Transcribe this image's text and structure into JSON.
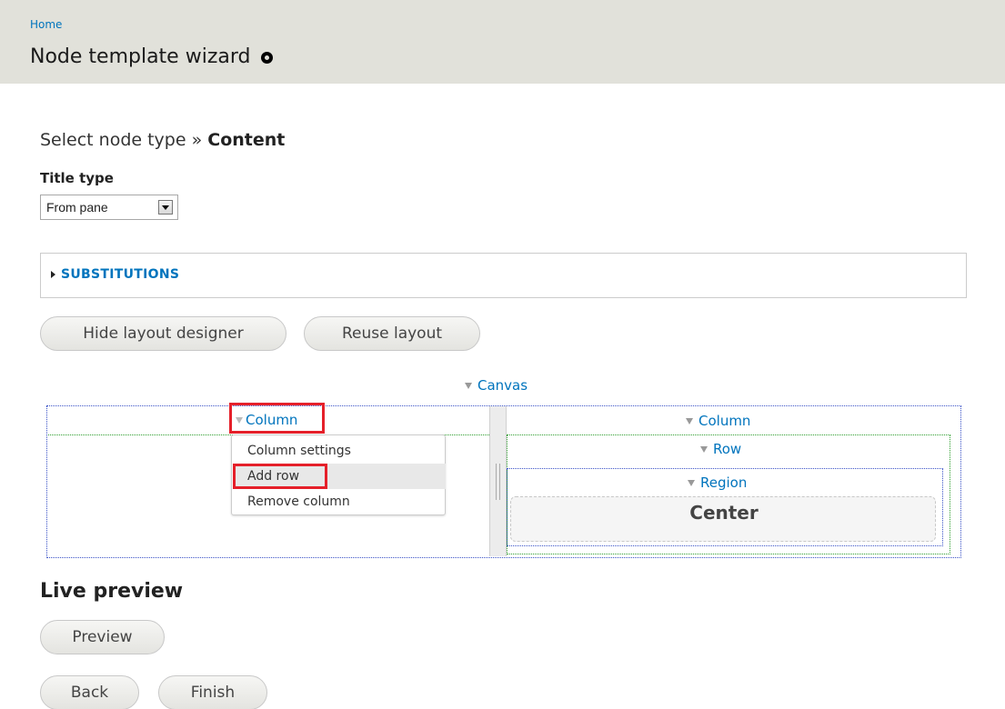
{
  "header": {
    "breadcrumb": "Home",
    "title": "Node template wizard",
    "shortcut_icon": "add-shortcut-icon"
  },
  "wizard": {
    "step_previous": "Select node type",
    "separator": " » ",
    "step_current": "Content"
  },
  "title_type": {
    "label": "Title type",
    "selected": "From pane"
  },
  "substitutions": {
    "legend": "SUBSTITUTIONS",
    "collapsed": true
  },
  "layout_buttons": {
    "hide_designer": "Hide layout designer",
    "reuse_layout": "Reuse layout"
  },
  "designer": {
    "canvas_label": "Canvas",
    "left_column_label": "Column",
    "right_column_label": "Column",
    "row_label": "Row",
    "region_label": "Region",
    "region_title": "Center",
    "popup_menu": [
      {
        "label": "Column settings"
      },
      {
        "label": "Add row"
      },
      {
        "label": "Remove column"
      }
    ],
    "highlight_color": "#e5202a",
    "link_color": "#0074bd"
  },
  "live_preview": {
    "title": "Live preview",
    "preview_button": "Preview"
  },
  "nav": {
    "back": "Back",
    "finish": "Finish"
  }
}
